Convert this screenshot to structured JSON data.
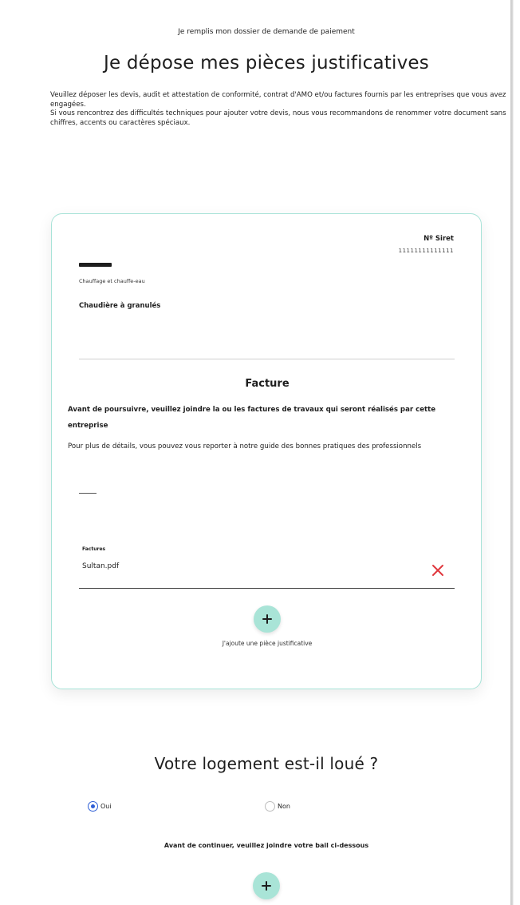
{
  "header": {
    "breadcrumb": "Je remplis mon dossier de demande de paiement",
    "title": "Je dépose mes pièces justificatives"
  },
  "intro": {
    "line1": "Veuillez déposer les devis, audit et attestation de conformité, contrat d'AMO et/ou factures fournis par les entreprises que vous avez engagées.",
    "line2": "Si vous rencontrez des difficultés techniques pour ajouter votre devis, nous vous recommandons de renommer votre document sans chiffres, accents ou caractères spéciaux."
  },
  "company_card": {
    "siret_label": "Nº Siret",
    "siret_value": "11111111111111",
    "category": "Chauffage et chauffe-eau",
    "work_type": "Chaudière à granulés",
    "section_title": "Facture",
    "notice": "Avant de poursuivre, veuillez joindre la ou les factures de travaux qui seront réalisés par cette entreprise",
    "guide_text": "Pour plus de détails, vous pouvez vous reporter à notre guide des bonnes pratiques des professionnels",
    "dashes": "——",
    "file_label": "Factures",
    "file_name": "Sultan.pdf",
    "add_label": "J'ajoute une pièce justificative"
  },
  "rental": {
    "question": "Votre logement est-il loué ?",
    "options": [
      {
        "label": "Oui",
        "selected": true
      },
      {
        "label": "Non",
        "selected": false
      }
    ],
    "notice": "Avant de continuer, veuillez joindre votre bail ci-dessous"
  },
  "colors": {
    "accent": "#a9e4d7",
    "card_border": "#a8e3d8",
    "remove": "#e0383e",
    "radio_selected": "#2f5fd6"
  },
  "icons": {
    "remove": "close-icon",
    "add": "plus-icon"
  }
}
